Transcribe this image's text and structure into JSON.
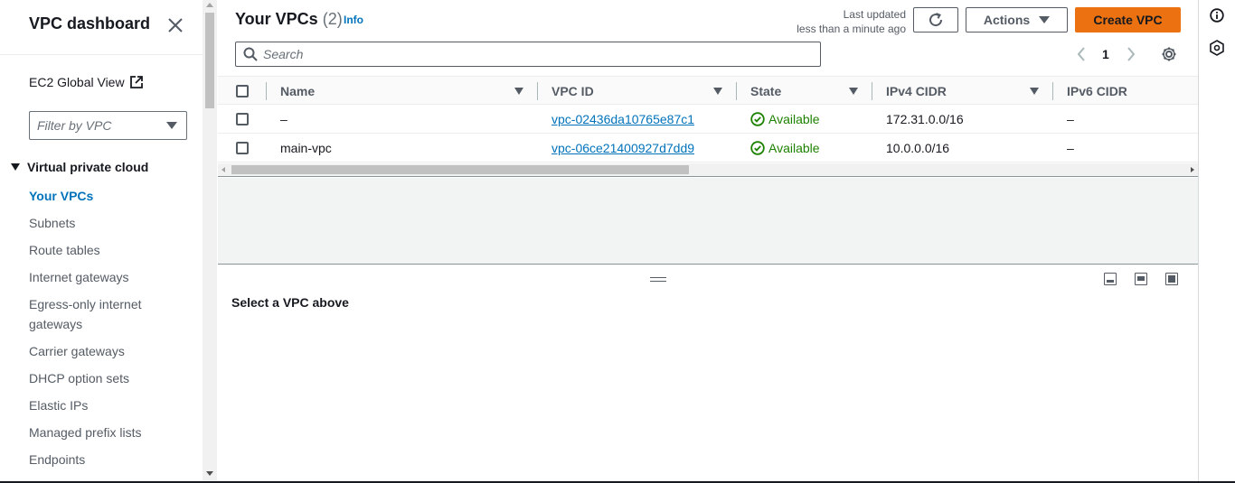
{
  "sidebar": {
    "title": "VPC dashboard",
    "global_view_label": "EC2 Global View",
    "filter_placeholder": "Filter by VPC",
    "section_label": "Virtual private cloud",
    "items": [
      {
        "label": "Your VPCs",
        "active": true
      },
      {
        "label": "Subnets"
      },
      {
        "label": "Route tables"
      },
      {
        "label": "Internet gateways"
      },
      {
        "label": "Egress-only internet gateways"
      },
      {
        "label": "Carrier gateways"
      },
      {
        "label": "DHCP option sets"
      },
      {
        "label": "Elastic IPs"
      },
      {
        "label": "Managed prefix lists"
      },
      {
        "label": "Endpoints"
      }
    ]
  },
  "header": {
    "title": "Your VPCs",
    "count": "(2)",
    "info": "Info",
    "last_updated_label": "Last updated",
    "last_updated_value": "less than a minute ago",
    "actions_label": "Actions",
    "create_label": "Create VPC"
  },
  "search": {
    "placeholder": "Search"
  },
  "pagination": {
    "current_page": "1"
  },
  "table": {
    "columns": [
      "Name",
      "VPC ID",
      "State",
      "IPv4 CIDR",
      "IPv6 CIDR"
    ],
    "rows": [
      {
        "name": "–",
        "vpc_id": "vpc-02436da10765e87c1",
        "state": "Available",
        "ipv4": "172.31.0.0/16",
        "ipv6": "–"
      },
      {
        "name": "main-vpc",
        "vpc_id": "vpc-06ce21400927d7dd9",
        "state": "Available",
        "ipv4": "10.0.0.0/16",
        "ipv6": "–"
      }
    ]
  },
  "detail": {
    "placeholder": "Select a VPC above"
  },
  "colors": {
    "accent": "#0073bb",
    "primary_button": "#ec7211",
    "success": "#1d8102"
  }
}
